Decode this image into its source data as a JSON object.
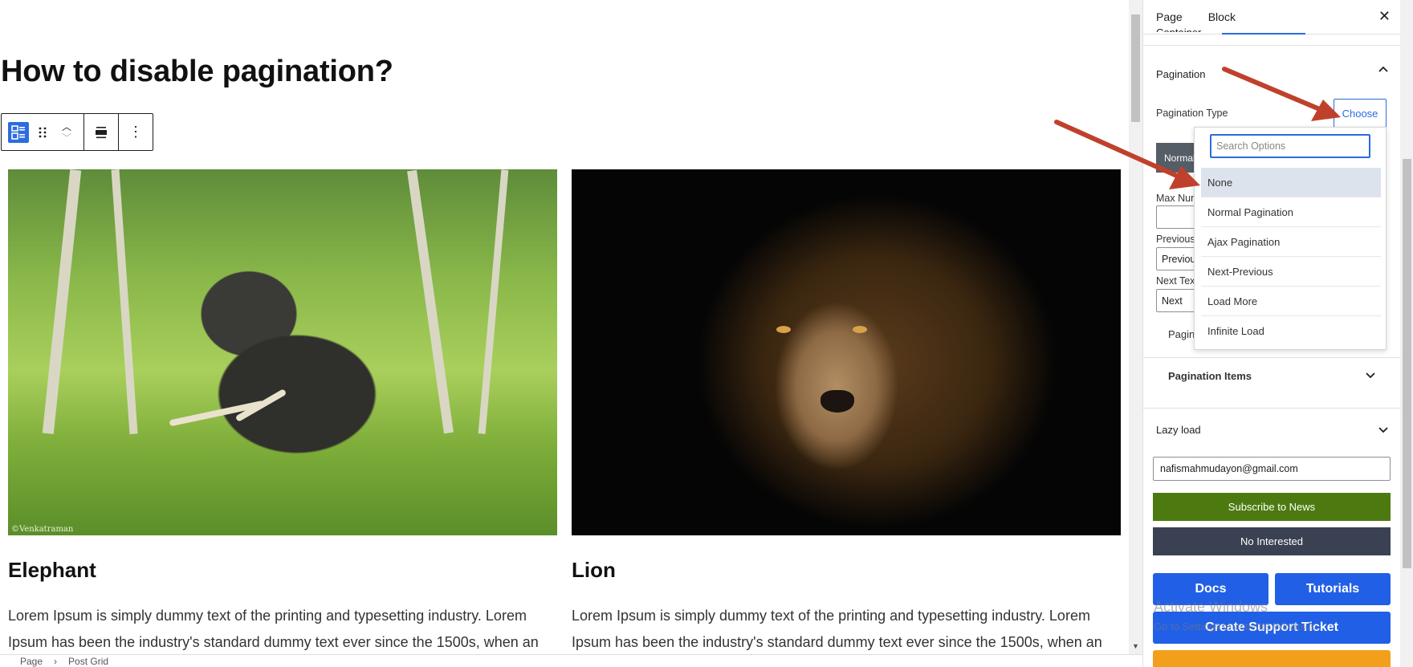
{
  "canvas": {
    "title": "How to disable pagination?",
    "posts": [
      {
        "title": "Elephant",
        "excerpt": "Lorem Ipsum is simply dummy text of the printing and typesetting industry. Lorem Ipsum has been the industry's standard dummy text ever since the 1500s, when an",
        "image_credit": "©Venkatraman"
      },
      {
        "title": "Lion",
        "excerpt": "Lorem Ipsum is simply dummy text of the printing and typesetting industry. Lorem Ipsum has been the industry's standard dummy text ever since the 1500s, when an"
      }
    ]
  },
  "breadcrumb": [
    "Page",
    "Post Grid"
  ],
  "sidebar": {
    "tabs": [
      "Page",
      "Block"
    ],
    "active_tab": "Block",
    "close_label": "✕",
    "container_label": "Container",
    "pagination": {
      "panel_title": "Pagination",
      "type_label": "Pagination Type",
      "choose_label": "Choose",
      "normal_tab_label": "Normal",
      "max_label": "Max Number",
      "prev_label": "Previous Text",
      "prev_value": "Previous",
      "next_label": "Next Text",
      "next_value": "Next",
      "subpanel_label": "Pagination",
      "items_label": "Pagination Items"
    },
    "dropdown": {
      "search_placeholder": "Search Options",
      "options": [
        "None",
        "Normal Pagination",
        "Ajax Pagination",
        "Next-Previous",
        "Load More",
        "Infinite Load"
      ],
      "highlighted": "None"
    },
    "lazy_load_label": "Lazy load",
    "email_value": "nafismahmudayon@gmail.com",
    "subscribe_label": "Subscribe to News",
    "not_interested_label": "No Interested",
    "docs_label": "Docs",
    "tutorials_label": "Tutorials",
    "ticket_label": "Create Support Ticket"
  },
  "watermark": {
    "line1": "Activate Windows",
    "line2": "Go to Settings to activate Windows."
  },
  "colors": {
    "accent": "#2b6cdf",
    "subscribe": "#4d7a10",
    "not_interested": "#3a4152",
    "action_blue": "#2160e6",
    "arrow": "#c0412b"
  }
}
